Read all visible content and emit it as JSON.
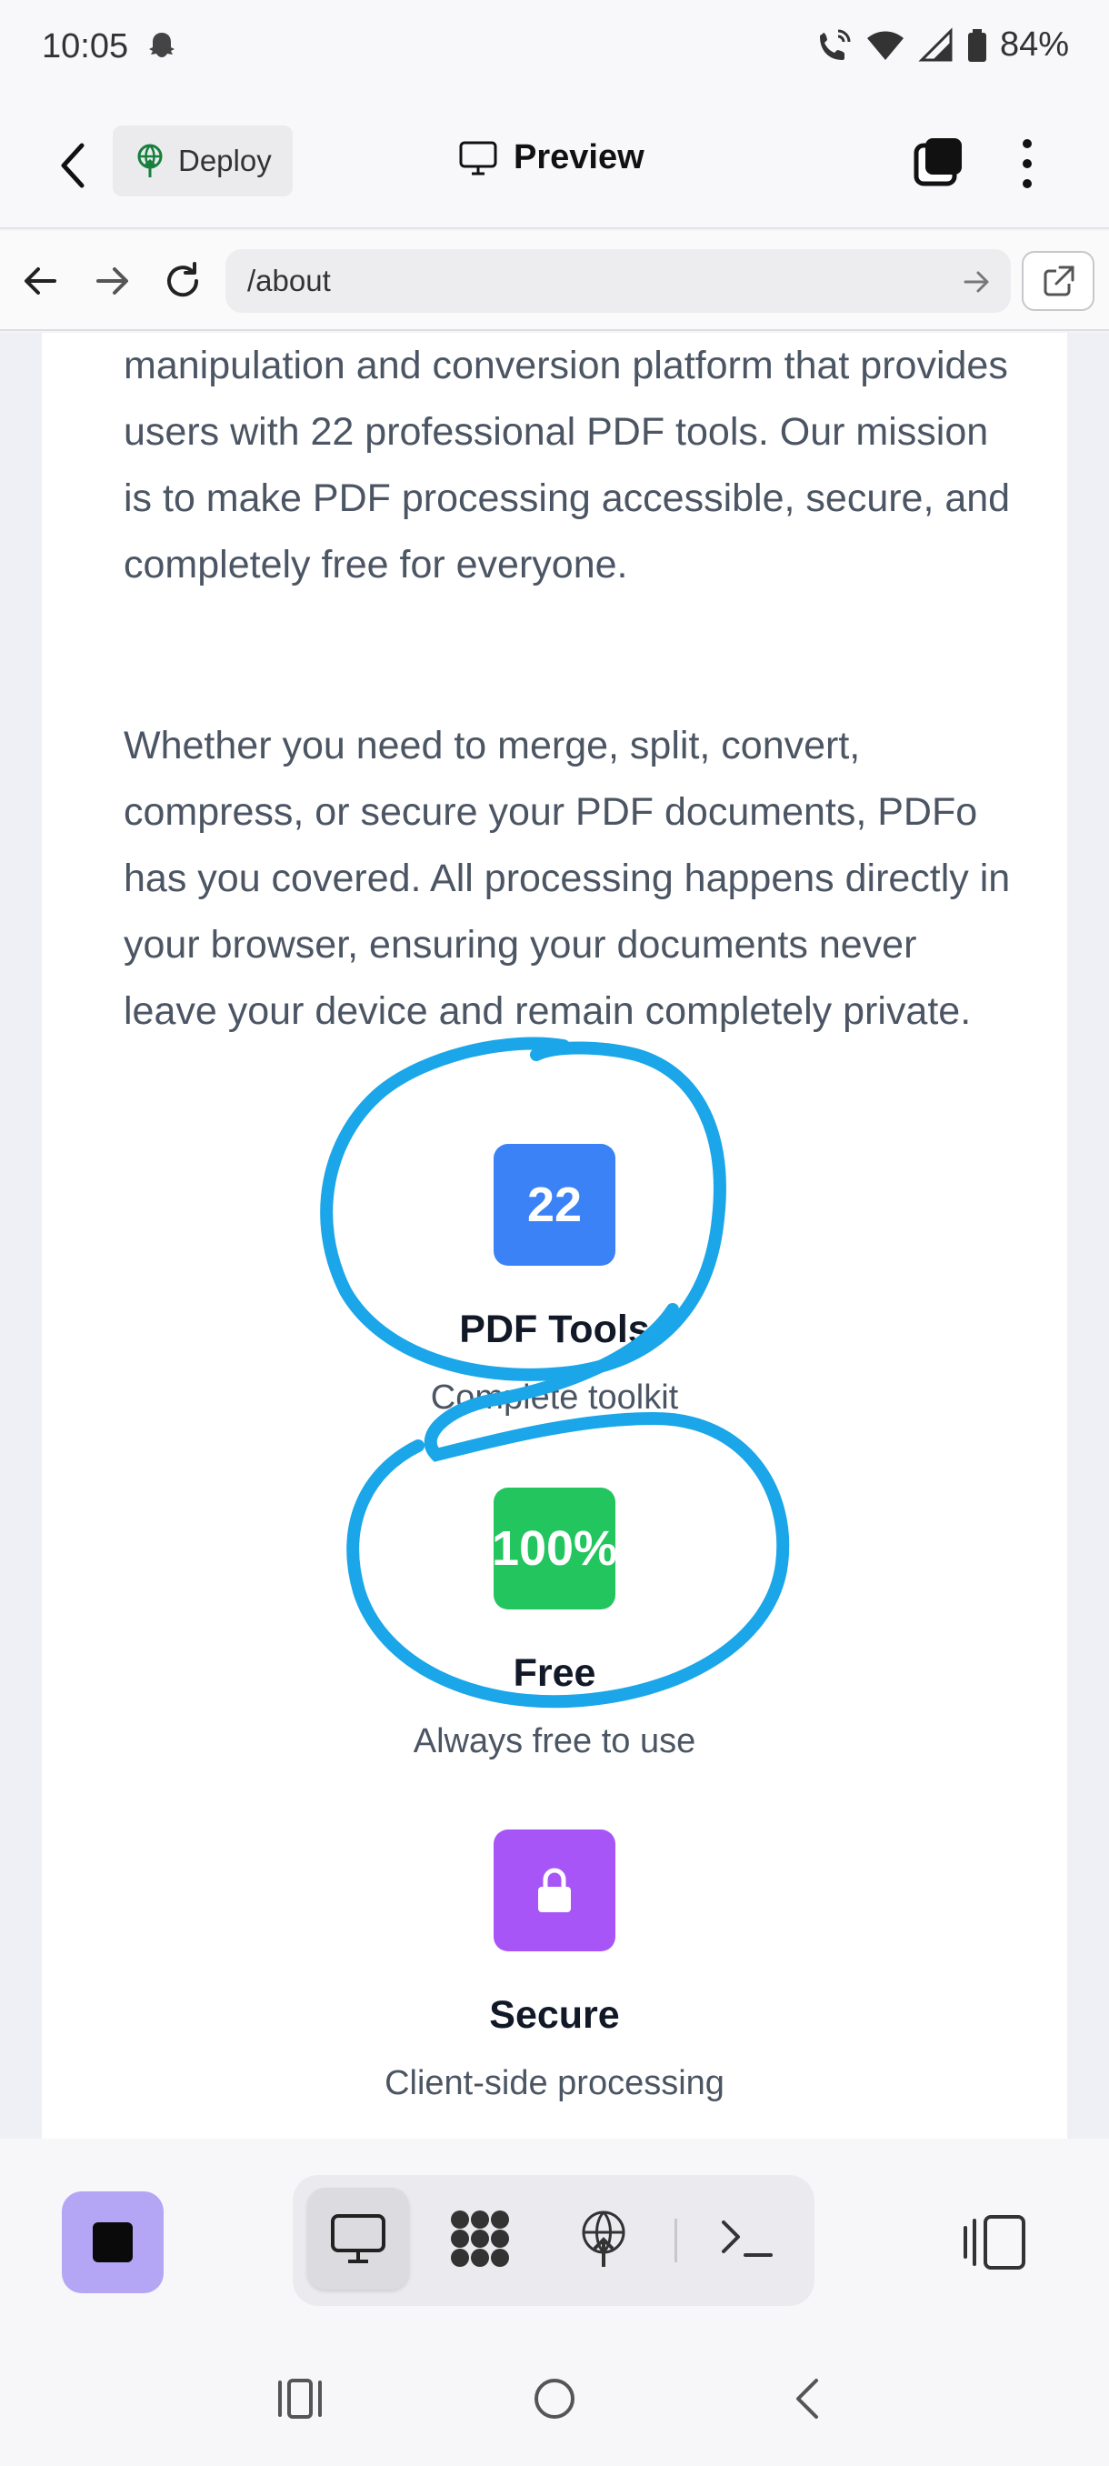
{
  "status_bar": {
    "time": "10:05",
    "battery": "84%",
    "icons": [
      "snapchat-ghost-icon",
      "wifi-call-icon",
      "wifi-icon",
      "signal-icon",
      "battery-icon"
    ]
  },
  "header": {
    "deploy_label": "Deploy",
    "preview_label": "Preview"
  },
  "url_bar": {
    "url": "/about"
  },
  "content": {
    "paragraph1": "manipulation and conversion platform that provides users with 22 professional PDF tools. Our mission is to make PDF processing accessible, secure, and completely free for everyone.",
    "paragraph2": "Whether you need to merge, split, convert, compress, or secure your PDF documents, PDFo has you covered. All processing happens directly in your browser, ensuring your documents never leave your device and remain completely private.",
    "stats": [
      {
        "value": "22",
        "title": "PDF Tools",
        "subtitle": "Complete toolkit",
        "color": "#3b82f6"
      },
      {
        "value": "100%",
        "title": "Free",
        "subtitle": "Always free to use",
        "color": "#22c55e"
      },
      {
        "value": "lock-icon",
        "title": "Secure",
        "subtitle": "Client-side processing",
        "color": "#a855f7"
      }
    ]
  },
  "annotation_color": "#1aa6e8",
  "toolbar": {
    "stop_color": "#b4a6f5",
    "tools": [
      "preview-icon",
      "dots-icon",
      "deploy-icon",
      "terminal-icon"
    ]
  }
}
